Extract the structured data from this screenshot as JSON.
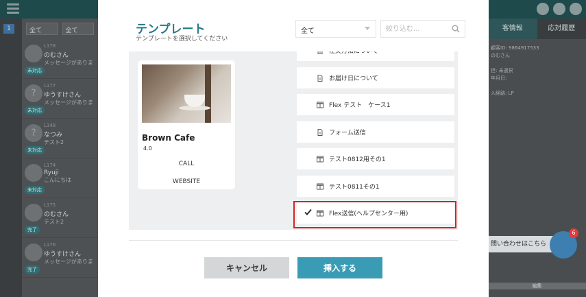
{
  "background": {
    "left_mark": "1",
    "filters": [
      "全て",
      "全て"
    ],
    "list_items": [
      {
        "code": "L178",
        "name": "のむさん",
        "message": "メッセージがありま",
        "badge": "未対応",
        "avatar": ""
      },
      {
        "code": "L177",
        "name": "ゆうすけさん",
        "message": "メッセージがありま",
        "badge": "未対応",
        "avatar": "?"
      },
      {
        "code": "L148",
        "name": "なつみ",
        "message": "テスト2",
        "badge": "未対応",
        "avatar": "?"
      },
      {
        "code": "L174",
        "name": "Ryuji",
        "message": "こんにちは",
        "badge": "未対応",
        "avatar": ""
      },
      {
        "code": "L175",
        "name": "のむさん",
        "message": "テスト2",
        "badge": "完了",
        "avatar": ""
      },
      {
        "code": "L176",
        "name": "ゆうすけさん",
        "message": "メッセージがありま",
        "badge": "完了",
        "avatar": ""
      }
    ],
    "right_tabs": [
      "客情報",
      "応対履歴"
    ],
    "right_info": [
      "顧客ID: 9864917533",
      "のむさん",
      "",
      "担: 未選択",
      "年月日:",
      "",
      "入経路: LP"
    ],
    "help_text": "問い合わせはこちら",
    "help_count": "6",
    "edit_label": "編集"
  },
  "modal": {
    "title": "テンプレート",
    "subtitle": "テンプレートを選択してください",
    "category": "全て",
    "search_placeholder": "絞り込む...",
    "preview": {
      "title": "Brown Cafe",
      "rating": "4.0",
      "call": "CALL",
      "website": "WEBSITE"
    },
    "templates": [
      {
        "label": "注文方法について",
        "icon": "document-icon",
        "selected": false
      },
      {
        "label": "お届け日について",
        "icon": "document-icon",
        "selected": false
      },
      {
        "label": "Flex テスト　ケース1",
        "icon": "flex-card-icon",
        "selected": false
      },
      {
        "label": "フォーム送信",
        "icon": "document-icon",
        "selected": false
      },
      {
        "label": "テスト0812用その1",
        "icon": "flex-card-icon",
        "selected": false
      },
      {
        "label": "テスト0811その1",
        "icon": "flex-card-icon",
        "selected": false
      },
      {
        "label": "Flex送信(ヘルプセンター用)",
        "icon": "flex-card-icon",
        "selected": true
      }
    ],
    "cancel_label": "キャンセル",
    "insert_label": "挿入する"
  }
}
